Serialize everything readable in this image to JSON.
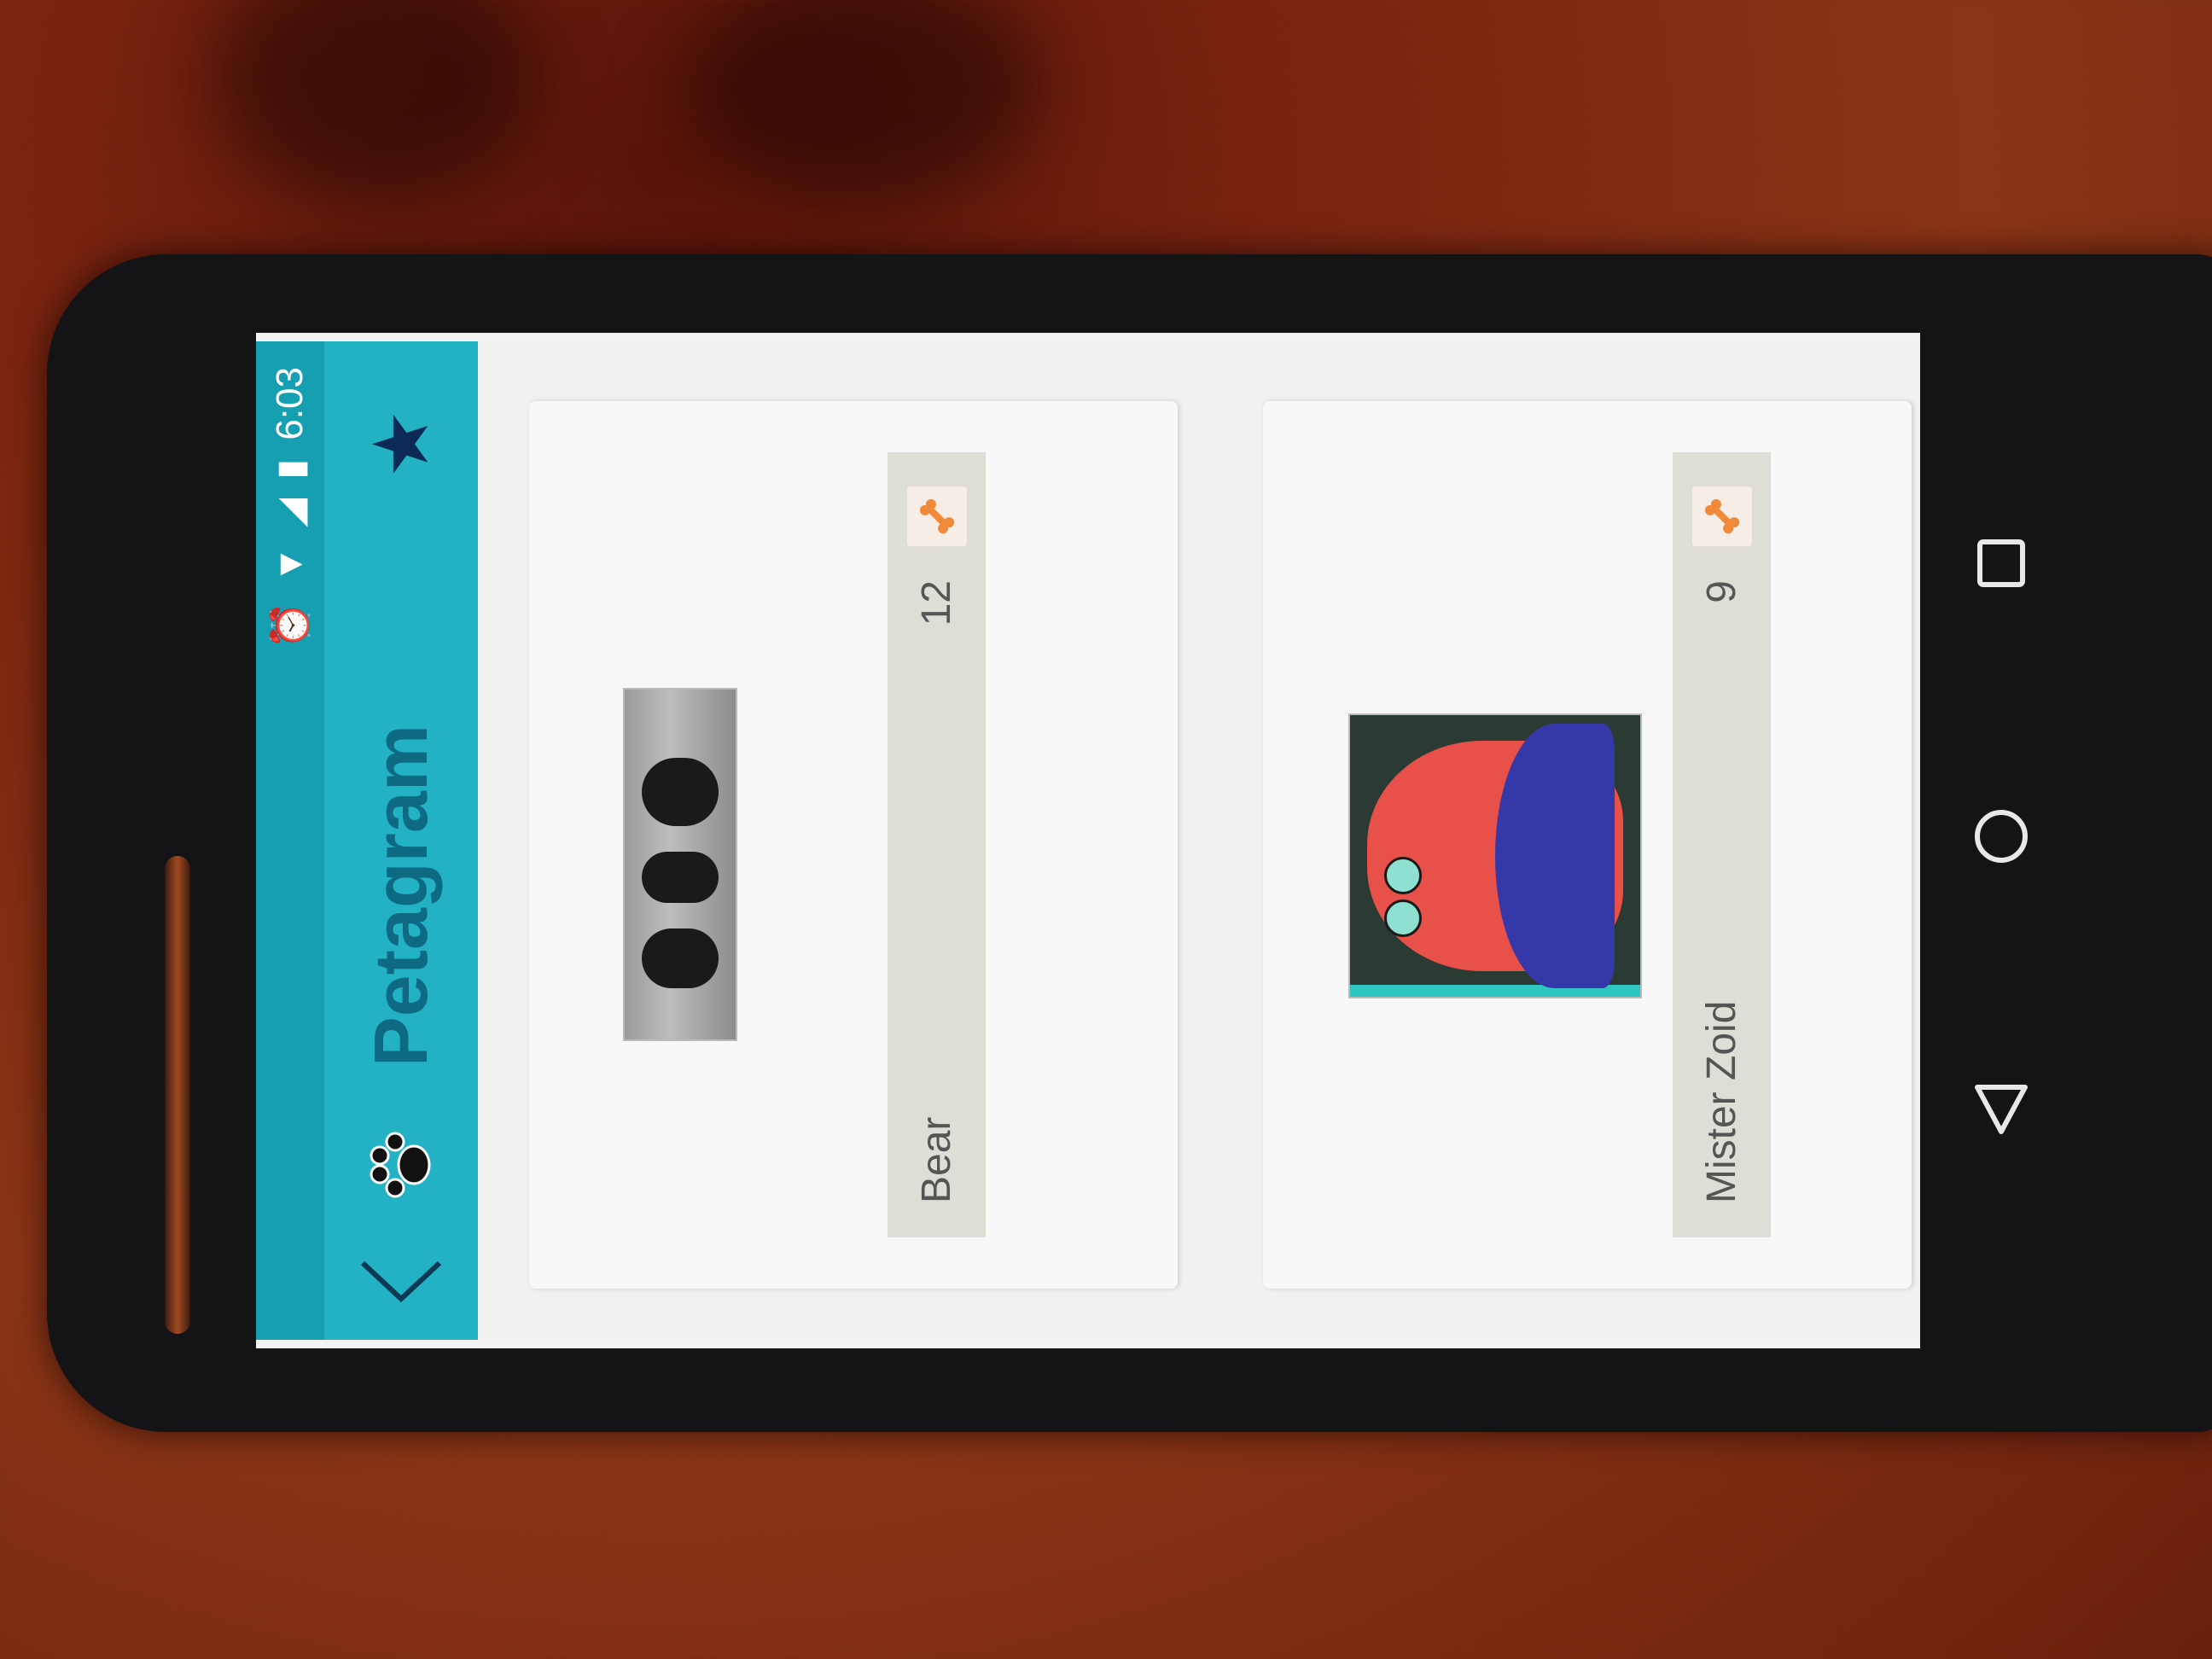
{
  "status_bar": {
    "time": "6:03",
    "icons": [
      "alarm-icon",
      "wifi-icon",
      "signal-icon",
      "battery-icon"
    ]
  },
  "toolbar": {
    "title": "Petagram",
    "icons": [
      "back-chevron-icon",
      "paw-icon",
      "star-icon"
    ]
  },
  "pets": [
    {
      "name": "Bear",
      "likes": "12",
      "icon": "bone-icon"
    },
    {
      "name": "Mister Zoid",
      "likes": "9",
      "icon": "bone-icon"
    }
  ],
  "colors": {
    "primary": "#22b2c4",
    "status_bar": "#159fb0",
    "title": "#0e6a82",
    "bone": "#f08a3a"
  },
  "nav": [
    "nav-recents-icon",
    "nav-home-icon",
    "nav-back-icon"
  ]
}
